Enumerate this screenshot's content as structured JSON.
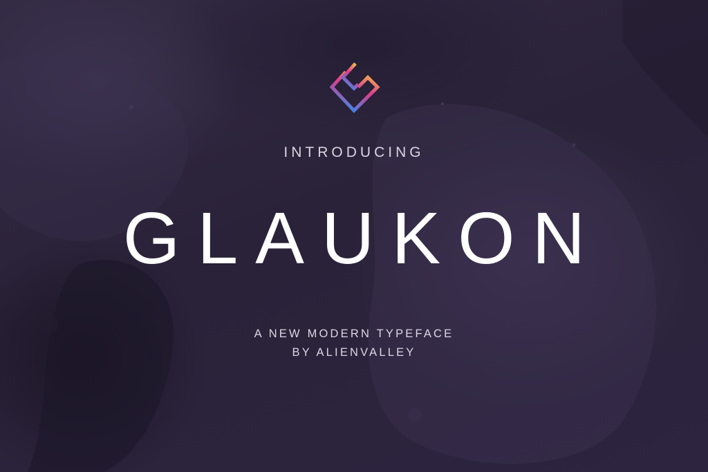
{
  "intro": "INTRODUCING",
  "title": "GLAUKON",
  "tagline": "A NEW MODERN TYPEFACE",
  "byline": "BY ALIENVALLEY",
  "colors": {
    "background": "#2a2238",
    "text": "#ffffff",
    "logo_gradient": [
      "#f2c34a",
      "#e23c8a",
      "#3b86e8"
    ]
  }
}
